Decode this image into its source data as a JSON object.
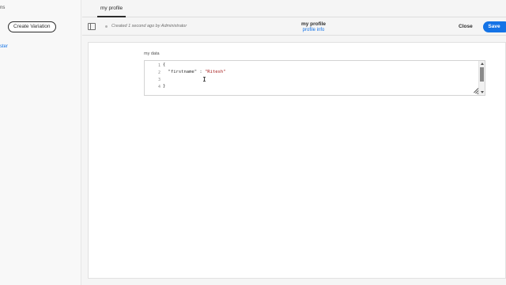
{
  "left_panel": {
    "top_text": "ns",
    "create_variation_label": "Create Variation",
    "link_text": "ster"
  },
  "tabs": [
    {
      "label": "my profile"
    }
  ],
  "toolbar": {
    "status_text": "Created 1 second ago by Administrator",
    "fragment_title": "my profile",
    "fragment_subtitle": "profile info",
    "close_label": "Close",
    "save_label": "Save"
  },
  "editor": {
    "label": "my data",
    "lines": [
      {
        "number": "1",
        "text": "{"
      },
      {
        "number": "2",
        "key": "  \"firstname\" : ",
        "value": "\"Ritesh\""
      },
      {
        "number": "3",
        "text": ""
      },
      {
        "number": "4",
        "text": "}"
      }
    ]
  },
  "colors": {
    "accent": "#1473e6",
    "string_value": "#a31515"
  },
  "icons": [
    "panel-toggle-icon",
    "status-dot-icon",
    "scroll-up-icon",
    "scroll-down-icon",
    "resize-handle-icon",
    "text-cursor-icon"
  ]
}
